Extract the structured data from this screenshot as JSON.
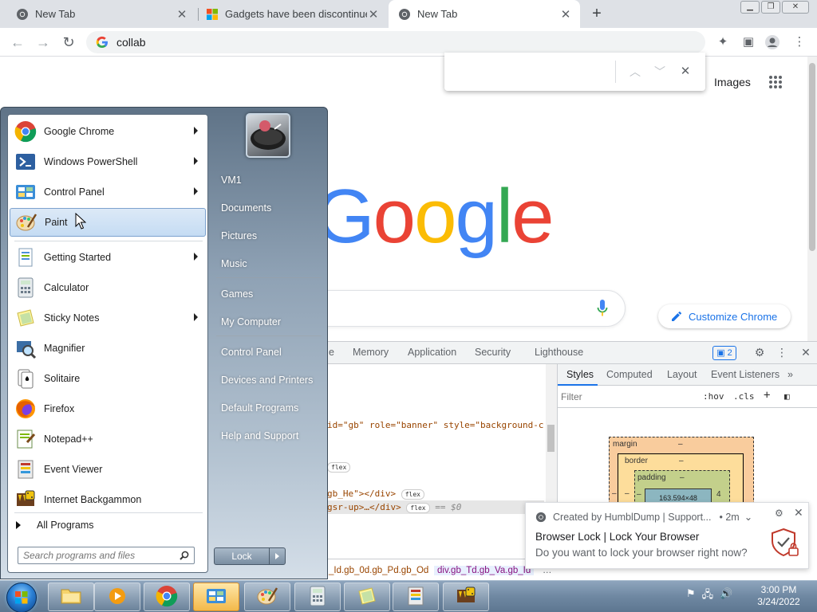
{
  "tabs": [
    {
      "title": "New Tab",
      "icon": "chrome-icon"
    },
    {
      "title": "Gadgets have been discontinued",
      "icon": "windows-icon"
    },
    {
      "title": "New Tab",
      "icon": "chrome-icon",
      "active": true
    }
  ],
  "omnibox": {
    "value": "collab"
  },
  "findbar": {
    "value": ""
  },
  "page": {
    "images_link": "Images",
    "logo": "Google",
    "customize_label": "Customize Chrome"
  },
  "devtools": {
    "tabs": [
      "Memory",
      "Application",
      "Security",
      "Lighthouse"
    ],
    "issues_count": "2",
    "code_lines": [
      {
        "pre": "id=\"gb\" role=\"banner\" style=\"background-c"
      },
      {
        "pill": "flex"
      },
      {
        "pre": "gb_He\"></div>",
        "pill": "flex"
      },
      {
        "pre": "gsr-up>…</div>",
        "pill": "flex",
        "post": "== $0"
      }
    ],
    "styles_tabs": [
      "Styles",
      "Computed",
      "Layout",
      "Event Listeners"
    ],
    "filter_placeholder": "Filter",
    "hov": ":hov",
    "cls": ".cls",
    "box": {
      "margin": "margin",
      "margin_val": "–",
      "border": "border",
      "border_val": "–",
      "padding": "padding",
      "padding_val": "–",
      "content": "163.594×48",
      "left": "–",
      "right": "4"
    },
    "breadcrumbs": [
      "_Id.gb_0d.gb_Pd.gb_Od",
      "div.gb_Td.gb_Va.gb_Id",
      "…"
    ]
  },
  "notification": {
    "source": "Created by HumblDump | Support...",
    "time": "• 2m",
    "title": "Browser Lock | Lock Your Browser",
    "message": "Do you want to lock your browser right now?"
  },
  "startmenu": {
    "programs": [
      {
        "label": "Google Chrome",
        "icon": "chrome-icon",
        "submenu": true
      },
      {
        "label": "Windows PowerShell",
        "icon": "powershell-icon",
        "submenu": true
      },
      {
        "label": "Control Panel",
        "icon": "control-panel-icon",
        "submenu": true
      },
      {
        "label": "Paint",
        "icon": "paint-icon",
        "submenu": false,
        "highlighted": true
      },
      {
        "label": "Getting Started",
        "icon": "getting-started-icon",
        "submenu": true
      },
      {
        "label": "Calculator",
        "icon": "calculator-icon",
        "submenu": false
      },
      {
        "label": "Sticky Notes",
        "icon": "sticky-notes-icon",
        "submenu": true
      },
      {
        "label": "Magnifier",
        "icon": "magnifier-icon",
        "submenu": false
      },
      {
        "label": "Solitaire",
        "icon": "solitaire-icon",
        "submenu": false
      },
      {
        "label": "Firefox",
        "icon": "firefox-icon",
        "submenu": false
      },
      {
        "label": "Notepad++",
        "icon": "notepadpp-icon",
        "submenu": false
      },
      {
        "label": "Event Viewer",
        "icon": "event-viewer-icon",
        "submenu": false
      },
      {
        "label": "Internet Backgammon",
        "icon": "backgammon-icon",
        "submenu": false
      }
    ],
    "all_programs": "All Programs",
    "search_placeholder": "Search programs and files",
    "right_items": [
      "VM1",
      "Documents",
      "Pictures",
      "Music",
      "Games",
      "My Computer",
      "Control Panel",
      "Devices and Printers",
      "Default Programs",
      "Help and Support"
    ],
    "lock_label": "Lock"
  },
  "taskbar": {
    "apps": [
      "explorer-icon",
      "media-player-icon",
      "chrome-icon",
      "control-panel-icon",
      "paint-icon",
      "calculator-icon",
      "sticky-notes-icon",
      "event-viewer-icon",
      "backgammon-icon"
    ],
    "time": "3:00 PM",
    "date": "3/24/2022"
  }
}
